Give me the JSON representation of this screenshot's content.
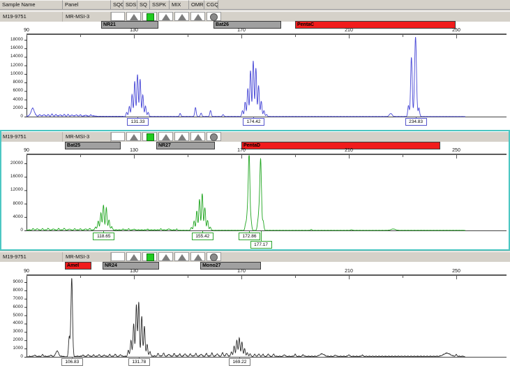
{
  "header": {
    "columns": [
      "Sample Name",
      "Panel",
      "SQO",
      "SDS",
      "SQ",
      "SSPK",
      "MIX",
      "OMR",
      "CGQ"
    ]
  },
  "colors": {
    "row_gray": "#d5d1c9",
    "selection_cyan": "#4cc7c3",
    "marker_gray": "#a0a0a0",
    "marker_red": "#f11c1c",
    "trace_blue": "#4747d6",
    "trace_green": "#1fa51f",
    "trace_black": "#2b2b2b"
  },
  "panels": [
    {
      "sample_name": "M19-9751",
      "panel": "MR-MSI-3",
      "selected": false,
      "qc_icons": [
        {
          "col": "SDS",
          "shape": "triangle"
        },
        {
          "col": "SQ",
          "shape": "square"
        },
        {
          "col": "SSPK",
          "shape": "triangle"
        },
        {
          "col": "MIX",
          "shape": "triangle"
        },
        {
          "col": "OMR",
          "shape": "triangle"
        },
        {
          "col": "CGQ",
          "shape": "circle"
        }
      ]
    },
    {
      "sample_name": "M19-9751",
      "panel": "MR-MSI-3",
      "selected": true,
      "qc_icons": [
        {
          "col": "SDS",
          "shape": "triangle"
        },
        {
          "col": "SQ",
          "shape": "square"
        },
        {
          "col": "SSPK",
          "shape": "triangle"
        },
        {
          "col": "MIX",
          "shape": "triangle"
        },
        {
          "col": "OMR",
          "shape": "triangle"
        },
        {
          "col": "CGQ",
          "shape": "circle"
        }
      ]
    },
    {
      "sample_name": "M19-9751",
      "panel": "MR-MSI-3",
      "selected": false,
      "qc_icons": [
        {
          "col": "SDS",
          "shape": "triangle"
        },
        {
          "col": "SQ",
          "shape": "square"
        },
        {
          "col": "SSPK",
          "shape": "triangle"
        },
        {
          "col": "MIX",
          "shape": "triangle"
        },
        {
          "col": "OMR",
          "shape": "triangle"
        },
        {
          "col": "CGQ",
          "shape": "circle"
        }
      ]
    }
  ],
  "chart_data": [
    {
      "type": "line",
      "dye": "blue",
      "trace_color": "#4747d6",
      "label_border": "#5555cc",
      "ylim": [
        0,
        18000
      ],
      "ytick_step": 2000,
      "xlim": [
        90,
        253
      ],
      "xticks": [
        90,
        130,
        170,
        210,
        250
      ],
      "markers": [
        {
          "label": "NR21",
          "start_bp": 117.8,
          "end_bp": 139.1,
          "color": "#a0a0a0"
        },
        {
          "label": "Bat26",
          "start_bp": 159.6,
          "end_bp": 184.8,
          "color": "#a0a0a0"
        },
        {
          "label": "PentaC",
          "start_bp": 190.0,
          "end_bp": 249.7,
          "color": "#f11c1c"
        }
      ],
      "noise_regions": [
        [
          90,
          116,
          260
        ],
        [
          116,
          126,
          90
        ],
        [
          136,
          170,
          60
        ],
        [
          180,
          232,
          50
        ],
        [
          236,
          253,
          40
        ]
      ],
      "peaks": [
        [
          92.3,
          1800,
          0.6
        ],
        [
          95,
          300
        ],
        [
          96.5,
          350
        ],
        [
          98,
          300
        ],
        [
          99.5,
          400
        ],
        [
          101,
          350
        ],
        [
          102.5,
          300
        ],
        [
          104,
          350
        ],
        [
          105.5,
          300
        ],
        [
          107,
          250
        ],
        [
          108.5,
          300
        ],
        [
          110,
          250
        ],
        [
          112,
          220
        ],
        [
          114,
          250
        ],
        [
          127.3,
          1000
        ],
        [
          128.3,
          2400
        ],
        [
          129.3,
          5200
        ],
        [
          130.3,
          8300
        ],
        [
          131.33,
          9900
        ],
        [
          132.3,
          8800
        ],
        [
          133.3,
          5100
        ],
        [
          134.3,
          2500
        ],
        [
          135.3,
          1000
        ],
        [
          147.2,
          700
        ],
        [
          152.9,
          2100
        ],
        [
          155.0,
          800
        ],
        [
          158.5,
          1400
        ],
        [
          163.2,
          450
        ],
        [
          170.4,
          1400
        ],
        [
          171.4,
          3400
        ],
        [
          172.4,
          6600
        ],
        [
          173.4,
          10800
        ],
        [
          174.42,
          13100
        ],
        [
          175.4,
          11400
        ],
        [
          176.4,
          7300
        ],
        [
          177.4,
          3600
        ],
        [
          178.4,
          1400
        ],
        [
          179.4,
          500
        ],
        [
          225.6,
          700,
          0.5
        ],
        [
          232.2,
          2600
        ],
        [
          233.3,
          13900,
          0.3
        ],
        [
          234.83,
          18700,
          0.35
        ],
        [
          236.1,
          2000
        ]
      ],
      "peak_labels": [
        {
          "text": "131.33",
          "bp": 131.33,
          "row": 0
        },
        {
          "text": "174.42",
          "bp": 174.42,
          "row": 0
        },
        {
          "text": "234.83",
          "bp": 234.83,
          "row": 0
        }
      ]
    },
    {
      "type": "line",
      "dye": "green",
      "trace_color": "#1fa51f",
      "label_border": "#2ea52e",
      "ylim": [
        0,
        20000
      ],
      "ytick_step": 4000,
      "xlim": [
        90,
        253
      ],
      "xticks": [
        90,
        130,
        170,
        210,
        250
      ],
      "markers": [
        {
          "label": "Bat25",
          "start_bp": 104.3,
          "end_bp": 125.1,
          "color": "#a0a0a0"
        },
        {
          "label": "NR27",
          "start_bp": 138.3,
          "end_bp": 160.1,
          "color": "#a0a0a0"
        },
        {
          "label": "PentaD",
          "start_bp": 170.0,
          "end_bp": 244.0,
          "color": "#f11c1c"
        }
      ],
      "noise_regions": [
        [
          90,
          146,
          260
        ],
        [
          146,
          151,
          80
        ],
        [
          159,
          171,
          70
        ],
        [
          179,
          253,
          60
        ]
      ],
      "peaks": [
        [
          92.5,
          350
        ],
        [
          94,
          400
        ],
        [
          96,
          350
        ],
        [
          98,
          450
        ],
        [
          100,
          350
        ],
        [
          102,
          400
        ],
        [
          104,
          450
        ],
        [
          106,
          300
        ],
        [
          108,
          350
        ],
        [
          110,
          300
        ],
        [
          112,
          350
        ],
        [
          113.5,
          400
        ],
        [
          115.7,
          900
        ],
        [
          116.7,
          2700
        ],
        [
          117.7,
          5100
        ],
        [
          118.65,
          7400
        ],
        [
          119.7,
          6600
        ],
        [
          120.7,
          3000
        ],
        [
          121.7,
          1000
        ],
        [
          126,
          250
        ],
        [
          128,
          300
        ],
        [
          130,
          250
        ],
        [
          135,
          220
        ],
        [
          140,
          300
        ],
        [
          143,
          350
        ],
        [
          146,
          250
        ],
        [
          151.4,
          900
        ],
        [
          152.4,
          2800
        ],
        [
          153.4,
          5800
        ],
        [
          154.4,
          9300
        ],
        [
          155.42,
          11000
        ],
        [
          156.4,
          6800
        ],
        [
          157.4,
          3000
        ],
        [
          158.4,
          1000
        ],
        [
          171.6,
          2000
        ],
        [
          172.2,
          4500
        ],
        [
          172.86,
          23500,
          0.3
        ],
        [
          173.6,
          2500
        ],
        [
          176.1,
          2200
        ],
        [
          176.6,
          4800
        ],
        [
          177.17,
          21000,
          0.3
        ],
        [
          178.1,
          2800
        ],
        [
          196,
          250
        ],
        [
          211,
          200
        ],
        [
          226.5,
          400,
          0.8
        ],
        [
          258,
          350,
          0.8
        ]
      ],
      "peak_labels": [
        {
          "text": "118.65",
          "bp": 118.65,
          "row": 0
        },
        {
          "text": "155.42",
          "bp": 155.42,
          "row": 0
        },
        {
          "text": "172.86",
          "bp": 172.86,
          "row": 0
        },
        {
          "text": "177.17",
          "bp": 177.17,
          "row": 1
        }
      ]
    },
    {
      "type": "line",
      "dye": "black",
      "trace_color": "#2b2b2b",
      "label_border": "#777777",
      "ylim": [
        0,
        9000
      ],
      "ytick_step": 1000,
      "xlim": [
        90,
        253
      ],
      "xticks": [
        90,
        130,
        170,
        210,
        250
      ],
      "markers": [
        {
          "label": "Amel",
          "start_bp": 104.3,
          "end_bp": 114.2,
          "color": "#f11c1c"
        },
        {
          "label": "NR24",
          "start_bp": 118.3,
          "end_bp": 139.4,
          "color": "#a0a0a0"
        },
        {
          "label": "Mono27",
          "start_bp": 154.7,
          "end_bp": 177.3,
          "color": "#a0a0a0"
        }
      ],
      "noise_regions": [
        [
          91,
          104,
          110
        ],
        [
          108,
          127,
          120
        ],
        [
          136,
          166,
          160
        ],
        [
          173,
          253,
          110
        ]
      ],
      "peaks": [
        [
          101.4,
          650,
          0.5
        ],
        [
          105.9,
          2400
        ],
        [
          106.83,
          9500,
          0.3
        ],
        [
          93,
          150
        ],
        [
          96,
          200
        ],
        [
          99,
          150
        ],
        [
          111,
          150
        ],
        [
          113,
          200
        ],
        [
          115,
          150
        ],
        [
          117,
          200
        ],
        [
          119,
          150
        ],
        [
          121,
          200
        ],
        [
          123,
          250
        ],
        [
          125,
          200
        ],
        [
          127.9,
          800
        ],
        [
          128.9,
          2000
        ],
        [
          129.9,
          4000
        ],
        [
          130.9,
          6300
        ],
        [
          131.78,
          6600
        ],
        [
          132.9,
          4900
        ],
        [
          133.9,
          3700
        ],
        [
          134.9,
          1500
        ],
        [
          135.9,
          600
        ],
        [
          139,
          300
        ],
        [
          141,
          350
        ],
        [
          143,
          250
        ],
        [
          145,
          300
        ],
        [
          147,
          250
        ],
        [
          149,
          300
        ],
        [
          151,
          250
        ],
        [
          153,
          300
        ],
        [
          155,
          250
        ],
        [
          157,
          300
        ],
        [
          159,
          350
        ],
        [
          161,
          300
        ],
        [
          163,
          400
        ],
        [
          164.5,
          350
        ],
        [
          166.3,
          600
        ],
        [
          167.3,
          1300
        ],
        [
          168.3,
          2000
        ],
        [
          169.22,
          2300
        ],
        [
          170.2,
          1800
        ],
        [
          171.2,
          1000
        ],
        [
          172.2,
          500
        ],
        [
          173.2,
          300
        ],
        [
          175,
          250
        ],
        [
          176.5,
          300
        ],
        [
          178,
          250
        ],
        [
          180,
          300
        ],
        [
          182,
          250
        ],
        [
          186,
          200
        ],
        [
          190,
          250
        ],
        [
          193,
          200
        ],
        [
          200,
          300,
          0.8
        ],
        [
          205,
          150
        ],
        [
          210,
          200
        ],
        [
          215,
          150
        ],
        [
          246.5,
          380,
          1.2
        ],
        [
          250,
          200
        ]
      ],
      "peak_labels": [
        {
          "text": "106.83",
          "bp": 106.83,
          "row": 0
        },
        {
          "text": "131.78",
          "bp": 131.78,
          "row": 0
        },
        {
          "text": "169.22",
          "bp": 169.22,
          "row": 0
        }
      ]
    }
  ]
}
